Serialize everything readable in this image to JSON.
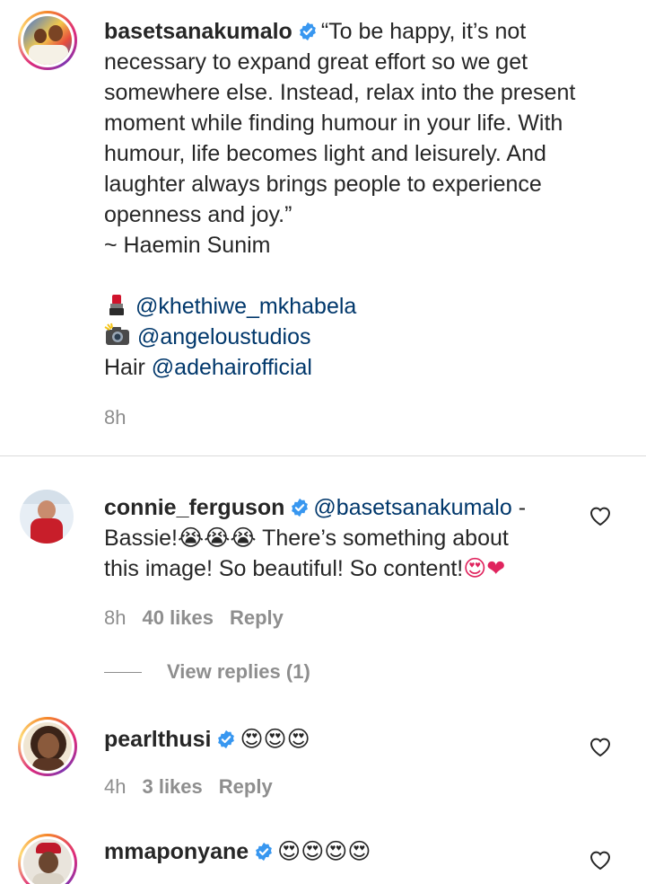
{
  "post": {
    "username": "basetsanakumalo",
    "caption_lines": [
      "“To be happy, it’s not",
      "necessary to expand great effort so we get",
      "somewhere else. Instead, relax into the present",
      "moment while finding humour in your life. With",
      "humour, life becomes light and leisurely. And",
      "laughter always brings people to experience",
      "openness and joy.”",
      "~ Haemin Sunim"
    ],
    "credit_makeup": "@khethiwe_mkhabela",
    "credit_photo": "@angeloustudios",
    "credit_hair_label": "Hair",
    "credit_hair": "@adehairofficial",
    "time": "8h"
  },
  "comments": [
    {
      "username": "connie_ferguson",
      "mention": "@basetsanakumalo",
      "text_after_mention": " -",
      "line2_text": "Bassie!",
      "line2_emoji": "😭😭😭",
      "line2_rest": " There’s something about",
      "line3_text": "this image! So beautiful! So content!",
      "line3_emoji": "😍❤",
      "time": "8h",
      "likes": "40 likes",
      "reply": "Reply",
      "view_replies": "View replies (1)"
    },
    {
      "username": "pearlthusi",
      "emoji": "😍😍😍",
      "time": "4h",
      "likes": "3 likes",
      "reply": "Reply"
    },
    {
      "username": "mmaponyane",
      "emoji": "😍😍😍😍"
    }
  ],
  "colors": {
    "verified": "#3897f0",
    "mention": "#00376b",
    "meta": "#8e8e8e"
  },
  "icons": [
    "verified-badge-icon",
    "heart-icon",
    "lipstick-icon",
    "camera-flash-icon"
  ]
}
